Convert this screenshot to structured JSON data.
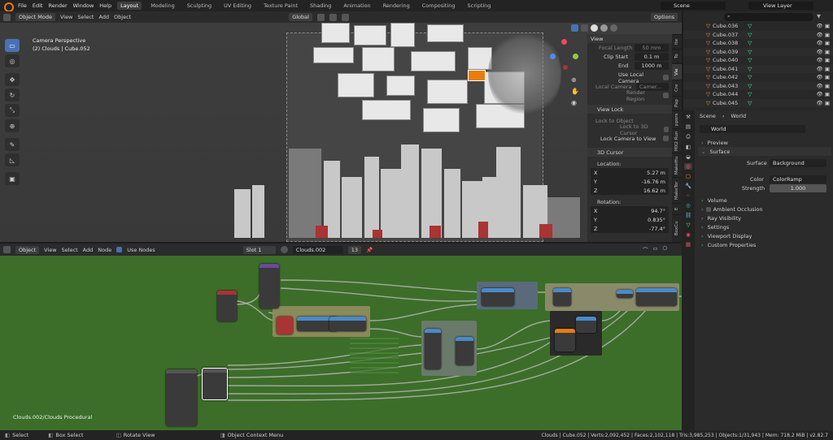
{
  "top_menu": [
    "File",
    "Edit",
    "Render",
    "Window",
    "Help"
  ],
  "workspaces": [
    "Layout",
    "Modeling",
    "Sculpting",
    "UV Editing",
    "Texture Paint",
    "Shading",
    "Animation",
    "Rendering",
    "Compositing",
    "Scripting"
  ],
  "active_workspace": "Layout",
  "scene_label": "Scene",
  "view_layer_label": "View Layer",
  "viewport": {
    "mode": "Object Mode",
    "menus": [
      "View",
      "Select",
      "Add",
      "Object"
    ],
    "orientation": "Global",
    "options": "Options",
    "overlay_title": "Camera Perspective",
    "overlay_object": "(2) Clouds | Cube.052"
  },
  "npanel": {
    "tabs": [
      "Ite",
      "To",
      "Vie",
      "Cre",
      "Pap",
      "ppors",
      "MX2 Run",
      "MakeHu",
      "MakeTor",
      "E",
      "BoxCu"
    ],
    "view_header": "View",
    "focal_length_label": "Focal Length",
    "focal_length": "50 mm",
    "clip_start_label": "Clip Start",
    "clip_start": "0.1 m",
    "end_label": "End",
    "end": "1000 m",
    "use_local_camera": "Use Local Camera",
    "local_camera_label": "Local Camera",
    "local_camera_value": "Camer...",
    "render_region": "Render Region",
    "view_lock_header": "View Lock",
    "lock_to_object": "Lock to Object",
    "lock_to_3d_cursor": "Lock to 3D Cursor",
    "lock_camera_to_view": "Lock Camera to View",
    "cursor_header": "3D Cursor",
    "location_label": "Location:",
    "loc": [
      {
        "axis": "X",
        "val": "5.27 m"
      },
      {
        "axis": "Y",
        "val": "-16.76 m"
      },
      {
        "axis": "Z",
        "val": "16.62 m"
      }
    ],
    "rotation_label": "Rotation:",
    "rot": [
      {
        "axis": "X",
        "val": "94.7°"
      },
      {
        "axis": "Y",
        "val": "0.835°"
      },
      {
        "axis": "Z",
        "val": "-77.4°"
      }
    ]
  },
  "outliner": {
    "items": [
      "Cube.036",
      "Cube.037",
      "Cube.038",
      "Cube.039",
      "Cube.040",
      "Cube.041",
      "Cube.042",
      "Cube.043",
      "Cube.044",
      "Cube.045"
    ]
  },
  "properties": {
    "scene": "Scene",
    "world": "World",
    "world_name": "World",
    "sections": {
      "preview": "Preview",
      "surface": "Surface",
      "volume": "Volume",
      "ambient_occlusion": "Ambient Occlusion",
      "ray_visibility": "Ray Visibility",
      "settings": "Settings",
      "viewport_display": "Viewport Display",
      "custom_properties": "Custom Properties"
    },
    "surface_label": "Surface",
    "surface_value": "Background",
    "color_label": "Color",
    "color_value": "ColorRamp",
    "strength_label": "Strength",
    "strength_value": "1.000"
  },
  "node_editor": {
    "type": "Object",
    "menus": [
      "View",
      "Select",
      "Add",
      "Node"
    ],
    "use_nodes": "Use Nodes",
    "slot": "Slot 1",
    "material": "Clouds.002",
    "users": "13",
    "breadcrumb": "Clouds.002/Clouds Procedural"
  },
  "status": {
    "select": "Select",
    "box_select": "Box Select",
    "rotate_view": "Rotate View",
    "context_menu": "Object Context Menu",
    "stats": "Clouds | Cube.052 | Verts:2,092,452 | Faces:2,102,118 | Tris:3,985,253 | Objects:1/31,943 | Mem: 718.2 MiB | v2.82.7"
  },
  "colors": {
    "accent": "#4772b3",
    "node_bg": "#3a7a28",
    "orange": "#e87d0d"
  }
}
